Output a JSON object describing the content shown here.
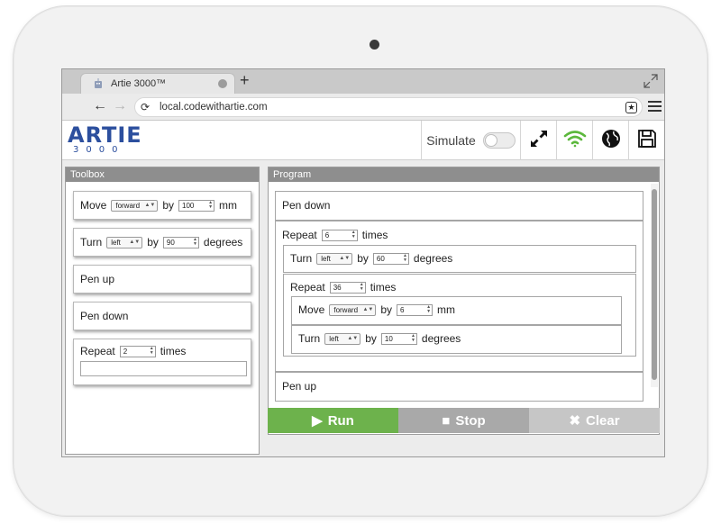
{
  "browser": {
    "tab_title": "Artie 3000™",
    "new_tab": "+",
    "url": "local.codewithartie.com"
  },
  "header": {
    "logo_main": "ARTIE",
    "logo_sub": "3000",
    "simulate_label": "Simulate",
    "simulate_on": false
  },
  "toolbox": {
    "title": "Toolbox",
    "move": {
      "label": "Move",
      "direction": "forward",
      "by": "by",
      "value": "100",
      "unit": "mm"
    },
    "turn": {
      "label": "Turn",
      "direction": "left",
      "by": "by",
      "value": "90",
      "unit": "degrees"
    },
    "pen_up": "Pen up",
    "pen_down": "Pen down",
    "repeat": {
      "label": "Repeat",
      "value": "2",
      "unit": "times"
    }
  },
  "program": {
    "title": "Program",
    "pen_down": "Pen down",
    "repeat_outer": {
      "label": "Repeat",
      "value": "6",
      "unit": "times"
    },
    "turn_outer": {
      "label": "Turn",
      "direction": "left",
      "by": "by",
      "value": "60",
      "unit": "degrees"
    },
    "repeat_inner": {
      "label": "Repeat",
      "value": "36",
      "unit": "times"
    },
    "move_inner": {
      "label": "Move",
      "direction": "forward",
      "by": "by",
      "value": "6",
      "unit": "mm"
    },
    "turn_inner": {
      "label": "Turn",
      "direction": "left",
      "by": "by",
      "value": "10",
      "unit": "degrees"
    },
    "pen_up": "Pen up"
  },
  "actions": {
    "run": "Run",
    "stop": "Stop",
    "clear": "Clear"
  },
  "colors": {
    "run": "#6db24c",
    "stop": "#a9a9a9",
    "clear": "#c6c6c6",
    "brand": "#2c4f9e",
    "wifi": "#5cb83c"
  },
  "icons": {
    "fullscreen": "diagonal-arrows-icon",
    "wifi": "wifi-icon",
    "globe": "globe-icon",
    "save": "floppy-disk-icon"
  }
}
